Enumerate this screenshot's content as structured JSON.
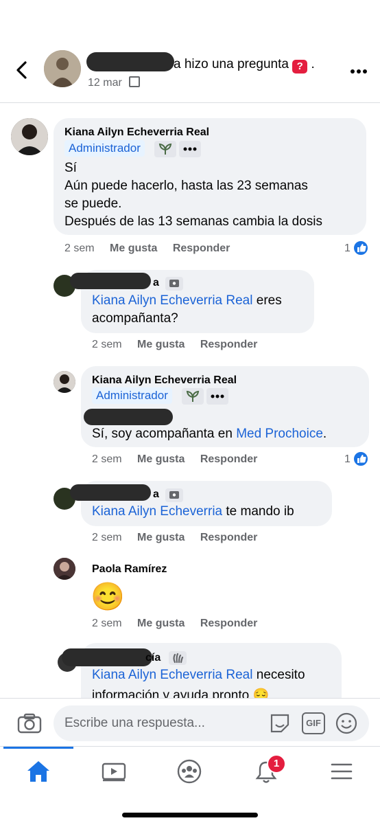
{
  "header": {
    "title_suffix": "a hizo una pregunta",
    "date": "12 mar",
    "dot": "."
  },
  "comments": [
    {
      "author": "Kiana Ailyn Echeverria Real",
      "badge": "Administrador",
      "lines": [
        "Sí",
        "Aún puede hacerlo, hasta las 23 semanas",
        "se puede.",
        "Después de las 13 semanas cambia la dosis"
      ],
      "time": "2 sem",
      "like": "Me gusta",
      "reply": "Responder",
      "likes": "1"
    },
    {
      "author_suffix": "a",
      "mention": "Kiana Ailyn Echeverria Real",
      "text_after": " eres",
      "line2": "acompañanta?",
      "time": "2 sem",
      "like": "Me gusta",
      "reply": "Responder"
    },
    {
      "author": "Kiana Ailyn Echeverria Real",
      "badge": "Administrador",
      "text_before": "Sí, soy acompañanta en ",
      "mention": "Med Prochoice",
      "text_after": ".",
      "time": "2 sem",
      "like": "Me gusta",
      "reply": "Responder",
      "likes": "1"
    },
    {
      "author_suffix": "a",
      "mention": "Kiana Ailyn Echeverria",
      "text_after": " te mando ib",
      "time": "2 sem",
      "like": "Me gusta",
      "reply": "Responder"
    },
    {
      "author": "Paola Ramírez",
      "emoji": "😊",
      "time": "2 sem",
      "like": "Me gusta",
      "reply": "Responder"
    },
    {
      "author_suffix": "cía",
      "mention": "Kiana Ailyn Echeverria Real",
      "text_after": " necesito",
      "line2": "información y ayuda pronto 😔"
    }
  ],
  "composer": {
    "placeholder": "Escribe una respuesta...",
    "gif": "GIF"
  },
  "nav": {
    "notifications_badge": "1"
  },
  "colors": {
    "accent": "#1b74e4",
    "link": "#1b63d6",
    "bubble": "#f0f2f5",
    "badge_red": "#e41e3f"
  }
}
